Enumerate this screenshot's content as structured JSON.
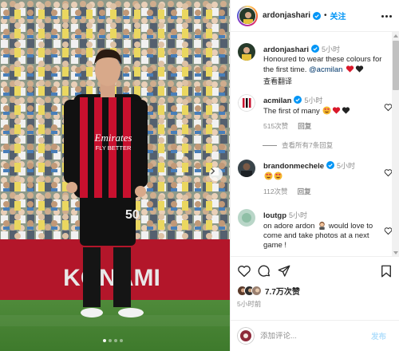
{
  "header": {
    "username": "ardonjashari",
    "separator": "•",
    "follow_label": "关注"
  },
  "caption": {
    "username": "ardonjashari",
    "time": "5小时",
    "text": "Honoured to wear these colours for the first time.",
    "mention": "@acmilan",
    "translate_label": "查看翻译"
  },
  "comments": [
    {
      "username": "acmilan",
      "time": "5小时",
      "text": "The first of many",
      "likes": "515次赞",
      "reply_label": "回复"
    },
    {
      "username": "brandonmechele",
      "time": "5小时",
      "text": "",
      "likes": "112次赞",
      "reply_label": "回复"
    },
    {
      "username": "loutgp",
      "time": "5小时",
      "text": "on adore ardon",
      "text2": "would love to come and take photos at a next game !",
      "likes": "",
      "reply_label": ""
    }
  ],
  "view_replies": "查看所有7条回复",
  "actions": {
    "likes_count": "7.7万次赞",
    "post_time": "5小时前"
  },
  "add_comment": {
    "placeholder": "添加评论...",
    "post_label": "发布"
  },
  "photo": {
    "banner_text": "KONAMI",
    "shirt_sponsor": "Emirates",
    "shirt_sponsor2": "FLY BETTER",
    "shirt_number": "50",
    "slide_count": 4,
    "active_slide": 1
  },
  "colors": {
    "accent": "#0095f6",
    "milan_red": "#c8102e",
    "milan_black": "#111111",
    "banner_red": "#b3162a"
  },
  "icons": [
    "heart-icon",
    "comment-icon",
    "share-icon",
    "bookmark-icon",
    "verified-icon",
    "more-icon",
    "chevron-right-icon"
  ]
}
